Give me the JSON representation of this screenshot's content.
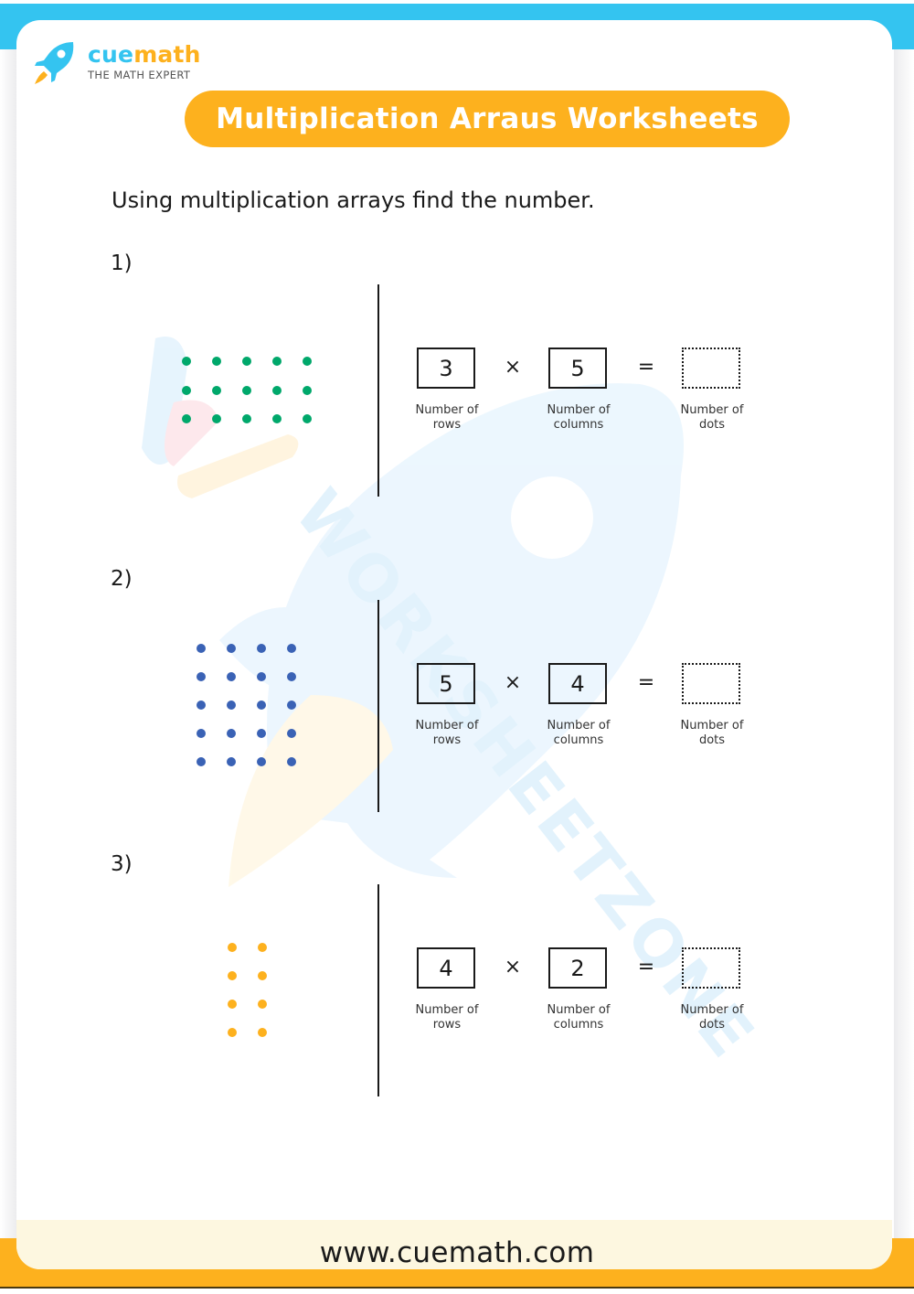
{
  "brand": {
    "name_part1": "cue",
    "name_part2": "math",
    "tagline": "THE MATH EXPERT",
    "logo_icon": "rocket-icon",
    "colors": {
      "blue": "#34c4f0",
      "yellow": "#fdb11e"
    }
  },
  "title": "Multiplication Arraus Worksheets",
  "instruction": "Using multiplication arrays find the number.",
  "watermark_text": "WORKSHEETZONE",
  "captions": {
    "rows": [
      "Number of",
      "rows"
    ],
    "columns": [
      "Number of",
      "columns"
    ],
    "dots": [
      "Number of",
      "dots"
    ]
  },
  "operators": {
    "times": "×",
    "equals": "="
  },
  "problems": [
    {
      "number": "1)",
      "rows": 3,
      "columns": 5,
      "rows_label": "3",
      "columns_label": "5",
      "answer": "",
      "dot_color": "#00a86b"
    },
    {
      "number": "2)",
      "rows": 5,
      "columns": 4,
      "rows_label": "5",
      "columns_label": "4",
      "answer": "",
      "dot_color": "#3a62b5"
    },
    {
      "number": "3)",
      "rows": 4,
      "columns": 2,
      "rows_label": "4",
      "columns_label": "2",
      "answer": "",
      "dot_color": "#fdb11e"
    }
  ],
  "footer": {
    "url": "www.cuemath.com"
  }
}
